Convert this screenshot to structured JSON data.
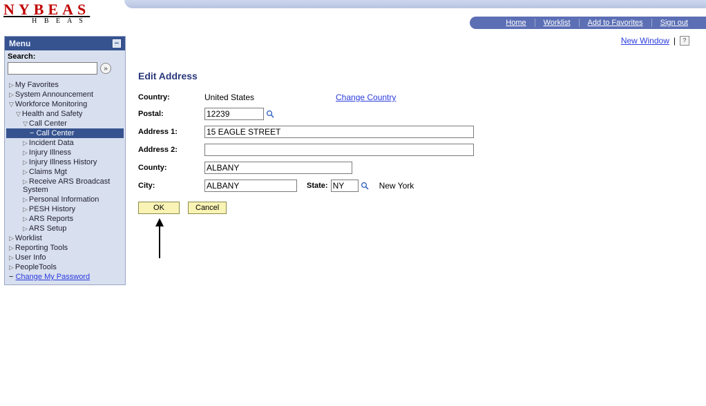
{
  "logo": {
    "main": "NYBEAS",
    "sub": "H B E A S"
  },
  "topnav": {
    "home": "Home",
    "worklist": "Worklist",
    "add_fav": "Add to Favorites",
    "sign_out": "Sign out"
  },
  "sidebar": {
    "menu_title": "Menu",
    "search_label": "Search:",
    "items": {
      "my_fav": "My Favorites",
      "sys_ann": "System Announcement",
      "wf_mon": "Workforce Monitoring",
      "health_safety": "Health and Safety",
      "call_center_parent": "Call Center",
      "call_center": "Call Center",
      "incident_data": "Incident Data",
      "injury_illness": "Injury Illness",
      "injury_illness_history": "Injury Illness History",
      "claims_mgt": "Claims Mgt",
      "receive_ars": "Receive ARS Broadcast System",
      "personal_info": "Personal Information",
      "pesh_history": "PESH History",
      "ars_reports": "ARS Reports",
      "ars_setup": "ARS Setup",
      "worklist": "Worklist",
      "reporting_tools": "Reporting Tools",
      "user_info": "User Info",
      "people_tools": "PeopleTools",
      "change_pw": "Change My Password"
    }
  },
  "main_links": {
    "new_window": "New Window",
    "help_alt": "help"
  },
  "page": {
    "title": "Edit Address",
    "labels": {
      "country": "Country:",
      "postal": "Postal:",
      "addr1": "Address 1:",
      "addr2": "Address 2:",
      "county": "County:",
      "city": "City:",
      "state": "State:"
    },
    "values": {
      "country": "United States",
      "change_country": "Change Country",
      "postal": "12239",
      "addr1": "15 EAGLE STREET",
      "addr2": "",
      "county": "ALBANY",
      "city": "ALBANY",
      "state": "NY",
      "state_name": "New York"
    },
    "buttons": {
      "ok": "OK",
      "cancel": "Cancel"
    }
  }
}
